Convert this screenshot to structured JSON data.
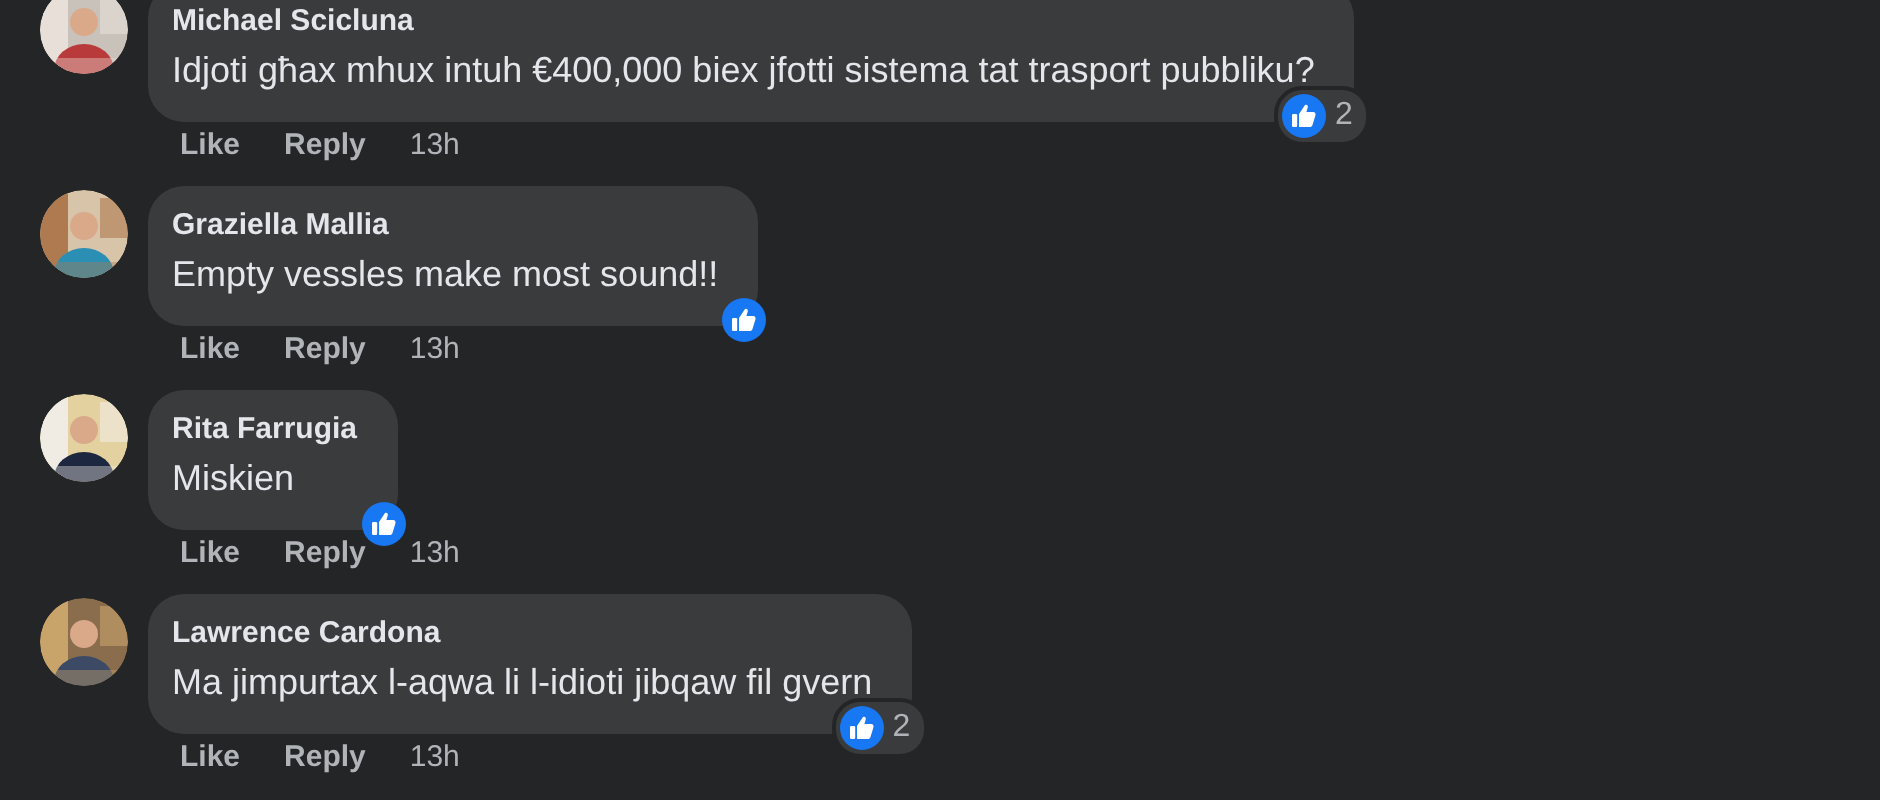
{
  "comments": [
    {
      "author": "Michael Scicluna",
      "text": "Idjoti għax mhux intuh €400,000 biex jfotti sistema tat trasport pubbliku?",
      "reaction": {
        "kind": "like",
        "count": "2"
      },
      "actions": [
        "Like",
        "Reply"
      ],
      "time": "13h"
    },
    {
      "author": "Graziella Mallia",
      "text": "Empty vessles make most sound!!",
      "reaction": {
        "kind": "like"
      },
      "actions": [
        "Like",
        "Reply"
      ],
      "time": "13h"
    },
    {
      "author": "Rita Farrugia",
      "text": "Miskien",
      "reaction": {
        "kind": "like"
      },
      "actions": [
        "Like",
        "Reply"
      ],
      "time": "13h"
    },
    {
      "author": "Lawrence Cardona",
      "text": "Ma jimpurtax l-aqwa li l-idioti jibqaw fil gvern",
      "reaction": {
        "kind": "like",
        "count": "2"
      },
      "actions": [
        "Like",
        "Reply"
      ],
      "time": "13h"
    }
  ]
}
